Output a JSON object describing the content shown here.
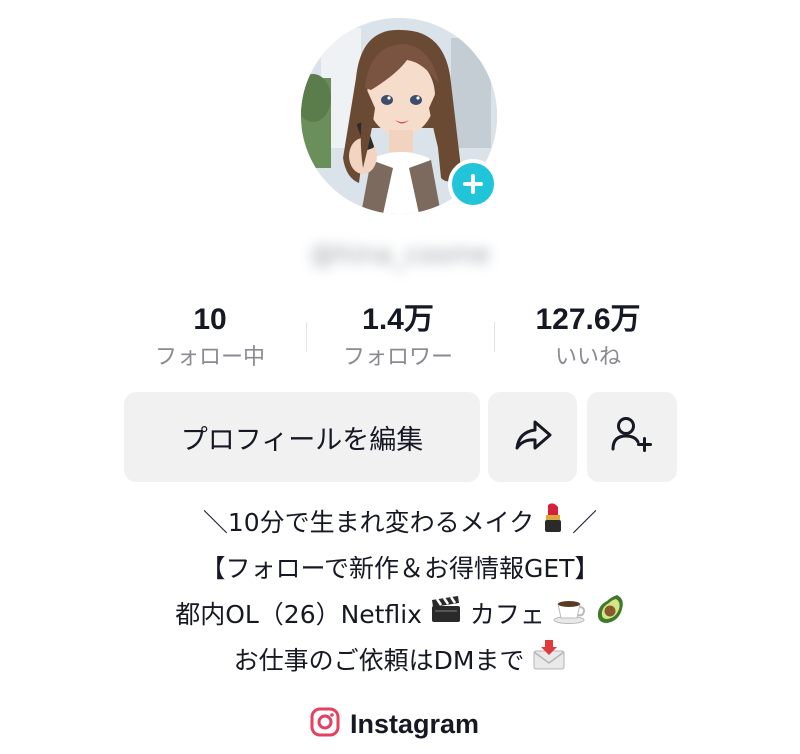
{
  "profile": {
    "username": "@hina_cosme"
  },
  "stats": [
    {
      "value": "10",
      "label": "フォロー中"
    },
    {
      "value": "1.4万",
      "label": "フォロワー"
    },
    {
      "value": "127.6万",
      "label": "いいね"
    }
  ],
  "buttons": {
    "edit_profile": "プロフィールを編集",
    "share_icon": "share-arrow-icon",
    "add_friend_icon": "add-friend-icon"
  },
  "bio": {
    "line1_before": "＼10分で生まれ変わるメイク",
    "line1_emoji": "lipstick-icon",
    "line1_after": "／",
    "line2": "【フォローで新作＆お得情報GET】",
    "line3_text1": "都内OL（26）Netflix",
    "line3_emoji1": "clapper-board-icon",
    "line3_text2": " カフェ",
    "line3_emoji2": "coffee-icon",
    "line3_emoji3": "avocado-icon",
    "line4_text": "お仕事のご依頼はDMまで",
    "line4_emoji": "inbox-tray-icon"
  },
  "link": {
    "label": "Instagram",
    "icon": "instagram-icon"
  },
  "colors": {
    "accent_plus": "#21c4d8",
    "text_primary": "#161823",
    "text_secondary": "#8a8b91",
    "button_bg": "#f1f1f2",
    "instagram_pink": "#e4405f"
  }
}
